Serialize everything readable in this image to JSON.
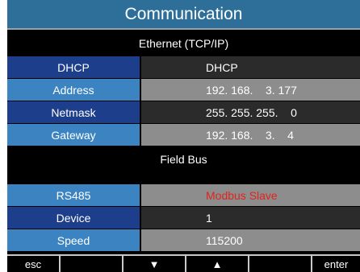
{
  "title": "Communication",
  "ethernet": {
    "header": "Ethernet (TCP/IP)",
    "rows": [
      {
        "label": "DHCP",
        "value": "DHCP"
      },
      {
        "label": "Address",
        "value": "192. 168.    3. 177"
      },
      {
        "label": "Netmask",
        "value": "255. 255. 255.    0"
      },
      {
        "label": "Gateway",
        "value": "192. 168.    3.    4"
      }
    ]
  },
  "fieldbus": {
    "header": "Field Bus",
    "rows": [
      {
        "label": "RS485",
        "value": "Modbus Slave",
        "value_color": "#e0241b"
      },
      {
        "label": "Device",
        "value": "1"
      },
      {
        "label": "Speed",
        "value": "115200"
      }
    ]
  },
  "softkeys": {
    "esc": "esc",
    "down": "▼",
    "up": "▲",
    "enter": "enter"
  },
  "colors": {
    "title_bg": "#2e6f9a",
    "label_dark": "#1d3e8a",
    "label_light": "#3b84c1",
    "value_dark": "#2b2b2b",
    "value_light": "#8d8d8d"
  }
}
